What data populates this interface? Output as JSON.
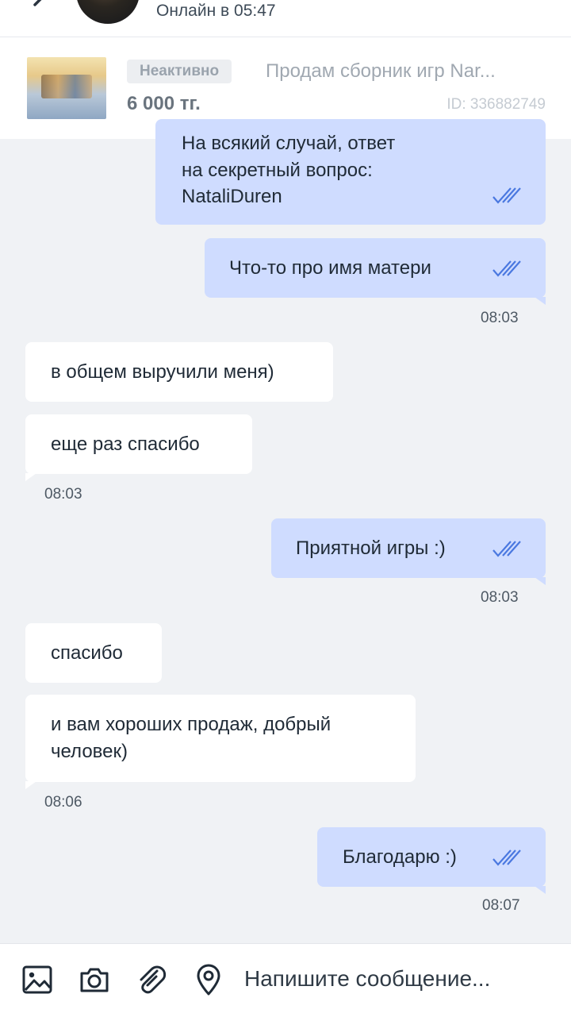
{
  "header": {
    "status": "Онлайн в 05:47"
  },
  "listing": {
    "badge": "Неактивно",
    "title": "Продам сборник игр Nar...",
    "price": "6 000 тг.",
    "id": "ID: 336882749"
  },
  "messages": [
    {
      "direction": "out",
      "lines": [
        "На всякий случай, ответ",
        "на секретный вопрос:",
        "NataliDuren"
      ],
      "read": true
    },
    {
      "direction": "out",
      "lines": [
        "Что-то про имя матери"
      ],
      "read": true
    },
    {
      "time": "08:03"
    },
    {
      "direction": "in",
      "lines": [
        "в общем выручили меня)"
      ]
    },
    {
      "direction": "in",
      "lines": [
        "еще раз спасибо"
      ]
    },
    {
      "time": "08:03"
    },
    {
      "direction": "out",
      "lines": [
        "Приятной игры :)"
      ],
      "read": true
    },
    {
      "time": "08:03"
    },
    {
      "direction": "in",
      "lines": [
        "спасибо"
      ]
    },
    {
      "direction": "in",
      "lines": [
        "и вам хороших продаж, добрый",
        "человек)"
      ]
    },
    {
      "time": "08:06"
    },
    {
      "direction": "out",
      "lines": [
        "Благодарю :)"
      ],
      "read": true
    },
    {
      "time": "08:07"
    }
  ],
  "composer": {
    "placeholder": "Напишите сообщение..."
  },
  "colors": {
    "outgoing_bubble": "#cfdcff",
    "incoming_bubble": "#ffffff",
    "background": "#f0f2f5",
    "read_check": "#4a78e0"
  },
  "icons": [
    "back-arrow-icon",
    "image-icon",
    "camera-icon",
    "paperclip-icon",
    "location-pin-icon",
    "double-check-icon"
  ]
}
